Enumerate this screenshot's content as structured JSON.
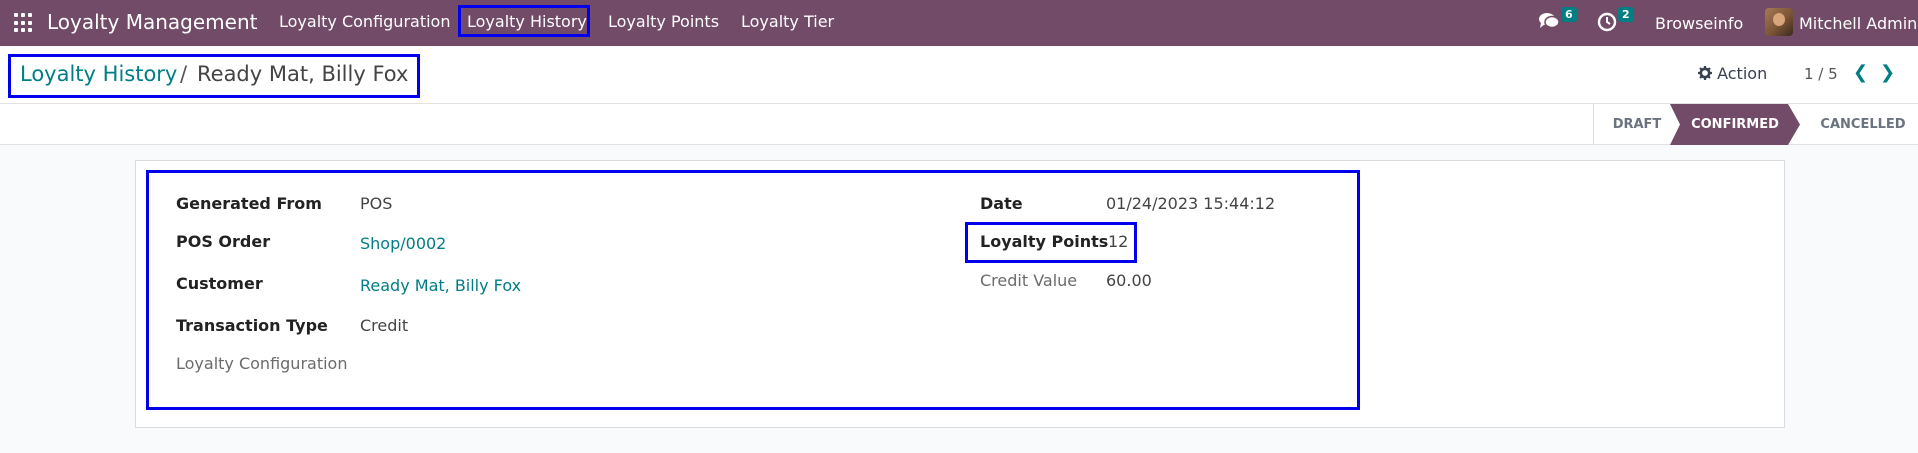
{
  "navbar": {
    "app_name": "Loyalty Management",
    "menu": [
      "Loyalty Configuration",
      "Loyalty History",
      "Loyalty Points",
      "Loyalty Tier"
    ],
    "messages_count": "6",
    "activities_count": "2",
    "company": "Browseinfo",
    "user": "Mitchell Admin"
  },
  "breadcrumb": {
    "parent": "Loyalty History",
    "separator": "/",
    "current": "Ready Mat, Billy Fox"
  },
  "toolbar": {
    "action_label": "Action",
    "pager": "1 / 5"
  },
  "statusbar": {
    "states": [
      "DRAFT",
      "CONFIRMED",
      "CANCELLED"
    ],
    "active": "CONFIRMED"
  },
  "form": {
    "left": [
      {
        "label": "Generated From",
        "value": "POS"
      },
      {
        "label": "POS Order",
        "value": "Shop/0002"
      },
      {
        "label": "Customer",
        "value": "Ready Mat, Billy Fox"
      },
      {
        "label": "Transaction Type",
        "value": "Credit"
      },
      {
        "label": "Loyalty Configuration",
        "value": ""
      }
    ],
    "right": [
      {
        "label": "Date",
        "value": "01/24/2023 15:44:12"
      },
      {
        "label": "Loyalty Points",
        "value": "12"
      },
      {
        "label": "Credit Value",
        "value": "60.00"
      }
    ]
  },
  "colors": {
    "brand": "#714b67",
    "link": "#017e84",
    "highlight": "#0000ee"
  }
}
